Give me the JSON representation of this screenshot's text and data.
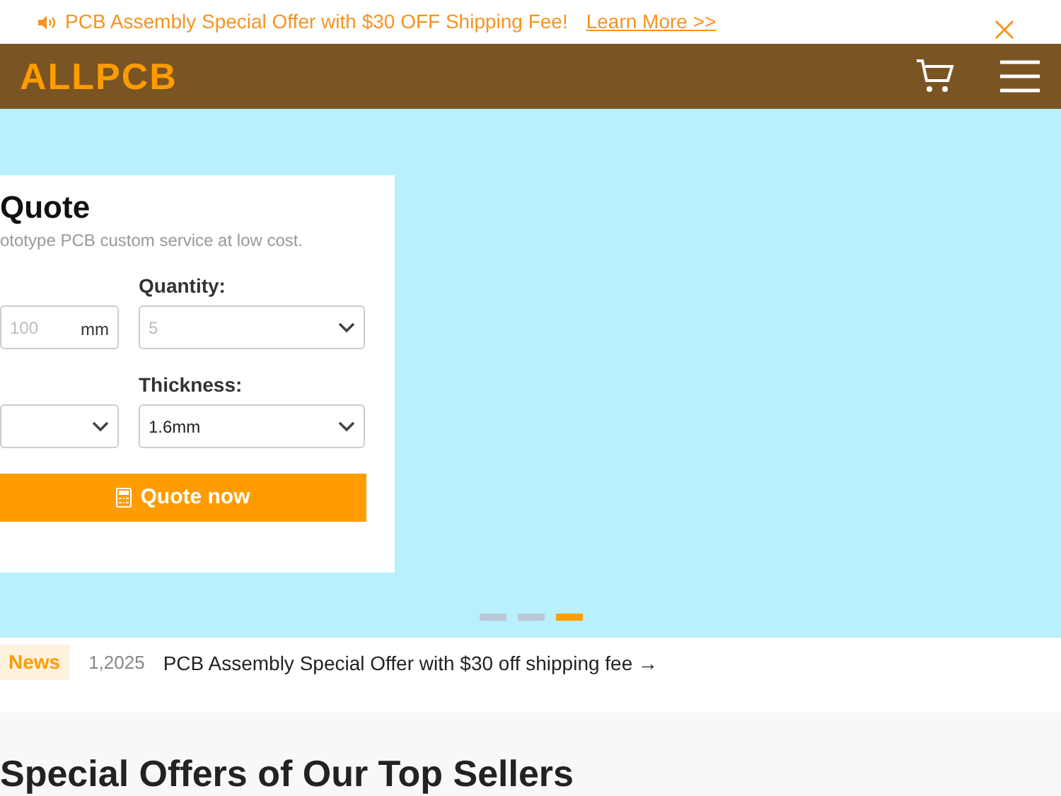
{
  "announcement": {
    "text": "PCB Assembly Special Offer with $30 OFF Shipping Fee!",
    "link": "Learn More >>"
  },
  "header": {
    "logo": "ALLPCB"
  },
  "quote_card": {
    "title": "Quote",
    "subtitle": "ototype PCB custom service at low cost.",
    "fields": [
      {
        "kind": "input",
        "placeholder": "100",
        "unit": "mm"
      },
      {
        "kind": "select",
        "label": "Quantity:",
        "placeholder": "5"
      },
      {
        "kind": "select"
      },
      {
        "kind": "select",
        "label": "Thickness:",
        "value": "1.6mm"
      }
    ],
    "button": "Quote now"
  },
  "carousel_dots": [
    {
      "selected": false
    },
    {
      "selected": false
    },
    {
      "selected": true
    }
  ],
  "news": {
    "badge": "News",
    "date": "1,2025",
    "headline": "PCB Assembly Special Offer with $30 off shipping fee",
    "arrow": "→"
  },
  "section": {
    "title": "Special Offers of Our Top Sellers"
  }
}
